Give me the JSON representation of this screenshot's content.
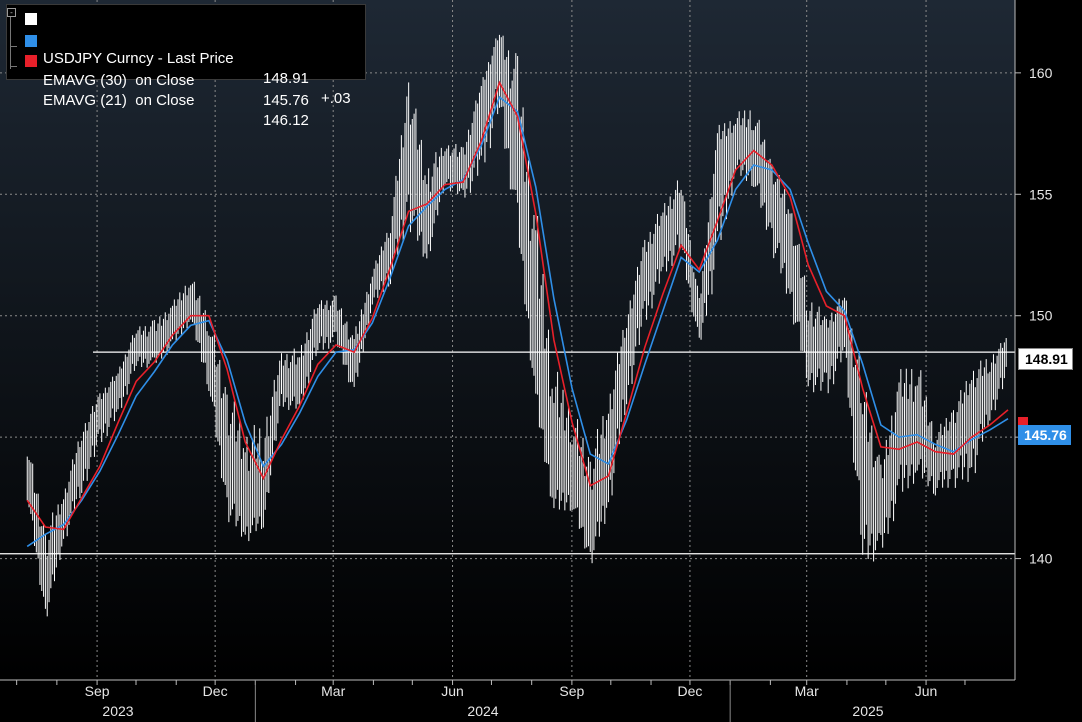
{
  "legend": {
    "price": {
      "name": "USDJPY Curncy - Last Price",
      "value": "148.91",
      "change": "+.03",
      "color": "#ffffff"
    },
    "ema30": {
      "name": "EMAVG (30)  on Close",
      "value": "145.76",
      "color": "#2f8fe8"
    },
    "ema21": {
      "name": "EMAVG (21)  on Close",
      "value": "146.12",
      "color": "#e8202a"
    }
  },
  "tags": {
    "price": "148.91",
    "ema30": "145.76"
  },
  "chart_data": {
    "type": "line",
    "y_ticks": [
      "140",
      "145",
      "150",
      "155",
      "160"
    ],
    "ylim": [
      135,
      163
    ],
    "x_month_ticks": [
      "Sep",
      "Dec",
      "Mar",
      "Jun",
      "Sep",
      "Dec",
      "Mar",
      "Jun"
    ],
    "x_year_labels": [
      "2023",
      "2024",
      "2025"
    ],
    "grid": true,
    "horizontal_reference_lines": [
      148.5,
      140.2
    ],
    "dates": [
      "2023-07-03",
      "2023-07-17",
      "2023-07-31",
      "2023-08-14",
      "2023-08-28",
      "2023-09-11",
      "2023-09-25",
      "2023-10-09",
      "2023-10-23",
      "2023-11-06",
      "2023-11-20",
      "2023-12-04",
      "2023-12-18",
      "2024-01-01",
      "2024-01-15",
      "2024-01-29",
      "2024-02-12",
      "2024-02-26",
      "2024-03-11",
      "2024-03-25",
      "2024-04-08",
      "2024-04-22",
      "2024-05-06",
      "2024-05-20",
      "2024-06-03",
      "2024-06-17",
      "2024-07-01",
      "2024-07-15",
      "2024-07-29",
      "2024-08-12",
      "2024-08-26",
      "2024-09-09",
      "2024-09-23",
      "2024-10-07",
      "2024-10-21",
      "2024-11-04",
      "2024-11-18",
      "2024-12-02",
      "2024-12-16",
      "2024-12-30",
      "2025-01-13",
      "2025-01-27",
      "2025-02-10",
      "2025-02-24",
      "2025-03-10",
      "2025-03-24",
      "2025-04-07",
      "2025-04-21",
      "2025-05-05",
      "2025-05-19",
      "2025-06-02",
      "2025-06-16",
      "2025-06-30",
      "2025-07-14",
      "2025-07-28"
    ],
    "series": [
      {
        "name": "USDJPY Curncy - Last Price",
        "color": "#ffffff",
        "style": "bars",
        "high": [
          145.1,
          141.5,
          142.8,
          145.5,
          146.9,
          147.8,
          149.6,
          149.9,
          150.6,
          151.8,
          150.2,
          147.4,
          145.6,
          145.8,
          148.6,
          148.8,
          150.7,
          150.9,
          149.4,
          151.9,
          154.0,
          160.2,
          156.5,
          157.2,
          157.1,
          159.7,
          161.9,
          161.0,
          155.2,
          148.3,
          146.5,
          144.6,
          146.9,
          150.3,
          153.3,
          154.7,
          155.9,
          150.8,
          157.9,
          158.4,
          158.9,
          156.5,
          155.0,
          151.2,
          150.0,
          151.1,
          148.2,
          144.0,
          147.9,
          148.6,
          145.3,
          146.4,
          148.0,
          148.5,
          149.2
        ],
        "low": [
          142.4,
          137.3,
          140.5,
          142.6,
          144.6,
          145.7,
          147.8,
          147.9,
          148.6,
          149.7,
          146.9,
          141.6,
          140.6,
          141.2,
          146.2,
          146.0,
          148.4,
          148.8,
          146.6,
          150.3,
          151.3,
          153.6,
          152.0,
          155.3,
          154.7,
          155.6,
          158.2,
          153.2,
          146.0,
          141.7,
          142.0,
          139.6,
          141.7,
          146.2,
          149.5,
          151.5,
          152.6,
          148.5,
          151.9,
          155.7,
          155.3,
          152.6,
          150.3,
          147.0,
          146.5,
          148.2,
          139.7,
          140.0,
          142.2,
          143.3,
          142.6,
          142.9,
          143.0,
          145.6,
          147.3
        ],
        "close": [
          143.6,
          138.8,
          141.8,
          144.3,
          146.1,
          147.2,
          148.9,
          148.6,
          149.8,
          150.5,
          148.5,
          143.8,
          142.2,
          142.5,
          147.4,
          147.1,
          149.9,
          149.8,
          147.9,
          151.2,
          153.0,
          156.9,
          153.5,
          156.4,
          155.7,
          158.9,
          161.2,
          155.9,
          148.2,
          143.8,
          143.5,
          141.2,
          144.3,
          148.8,
          151.8,
          153.2,
          154.4,
          149.6,
          156.3,
          157.2,
          156.8,
          155.0,
          152.8,
          148.6,
          148.9,
          149.9,
          143.5,
          141.8,
          145.2,
          145.1,
          144.1,
          144.8,
          146.2,
          147.0,
          148.91
        ]
      },
      {
        "name": "EMAVG (30)  on Close",
        "color": "#2f8fe8",
        "values": [
          140.5,
          141.0,
          141.4,
          142.4,
          143.6,
          145.1,
          146.7,
          147.7,
          148.8,
          149.6,
          149.8,
          148.2,
          145.6,
          143.8,
          144.7,
          146.0,
          147.5,
          148.5,
          148.6,
          149.7,
          151.6,
          153.7,
          154.5,
          155.2,
          155.6,
          157.0,
          159.0,
          158.4,
          155.3,
          150.7,
          147.0,
          144.3,
          143.9,
          145.7,
          148.0,
          150.2,
          152.4,
          151.8,
          153.1,
          155.2,
          156.2,
          156.0,
          155.2,
          153.0,
          151.0,
          150.2,
          148.0,
          145.5,
          145.0,
          145.1,
          144.7,
          144.4,
          144.9,
          145.3,
          145.76
        ]
      },
      {
        "name": "EMAVG (21)  on Close",
        "color": "#e8202a",
        "values": [
          142.4,
          141.3,
          141.2,
          142.5,
          143.8,
          145.6,
          147.3,
          148.1,
          149.2,
          150.0,
          150.0,
          147.8,
          144.8,
          143.3,
          144.9,
          146.3,
          148.0,
          148.8,
          148.5,
          149.9,
          152.0,
          154.3,
          154.6,
          155.4,
          155.5,
          157.2,
          159.6,
          158.2,
          154.2,
          149.0,
          145.6,
          143.0,
          143.4,
          146.0,
          148.7,
          150.9,
          152.9,
          151.9,
          153.9,
          156.0,
          156.8,
          156.2,
          154.9,
          152.1,
          150.4,
          150.0,
          147.0,
          144.6,
          144.5,
          144.8,
          144.4,
          144.3,
          145.0,
          145.5,
          146.12
        ]
      }
    ]
  }
}
